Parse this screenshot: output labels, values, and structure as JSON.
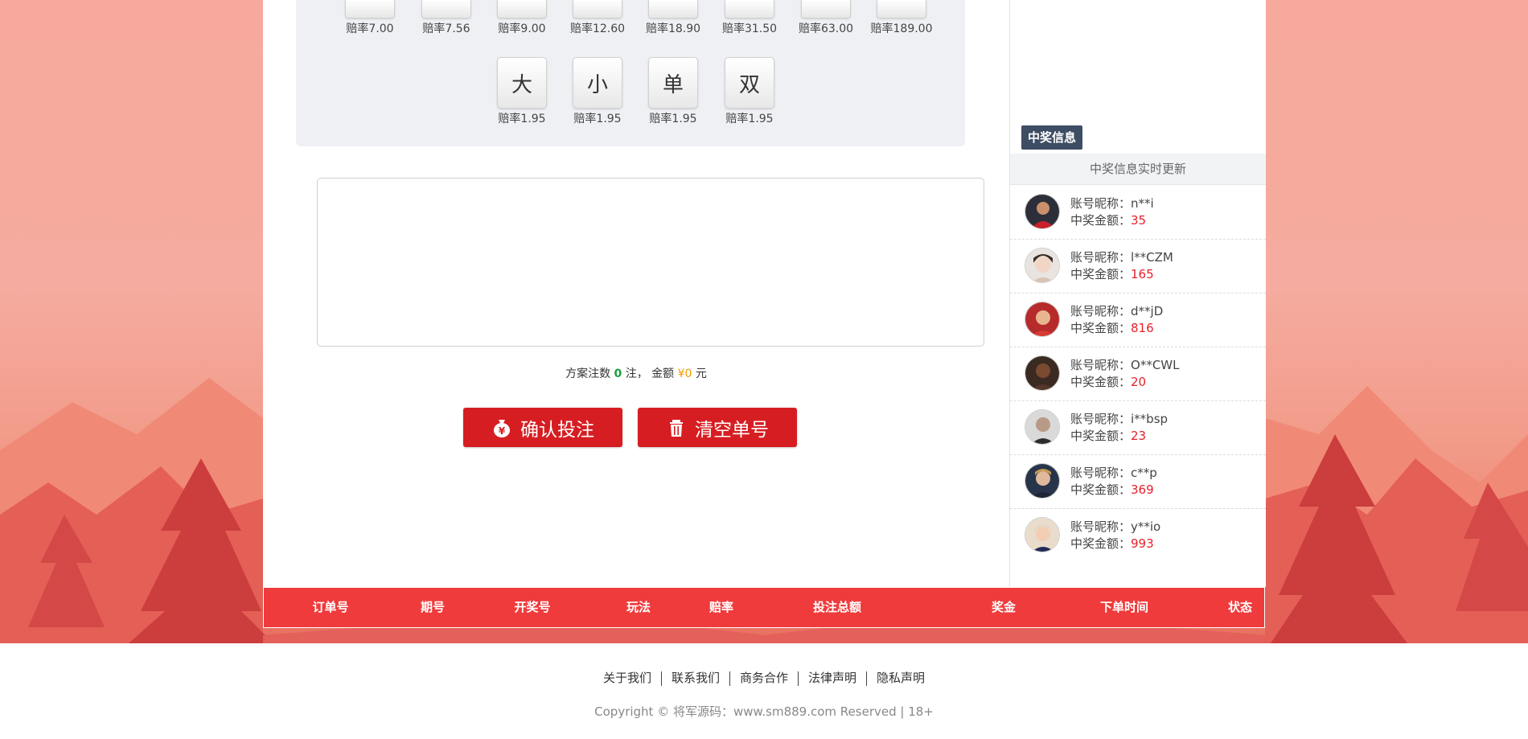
{
  "colors": {
    "accent_red": "#d61e22",
    "table_header_red": "#ef3b3c",
    "count_green": "#1a9f3a",
    "money_orange": "#f59c00",
    "amount_red": "#e8202a",
    "badge_navy": "#3d4d63"
  },
  "odds": {
    "row1": [
      "赔率7.00",
      "赔率7.56",
      "赔率9.00",
      "赔率12.60",
      "赔率18.90",
      "赔率31.50",
      "赔率63.00",
      "赔率189.00"
    ],
    "row2": [
      {
        "key": "大",
        "rate": "赔率1.95"
      },
      {
        "key": "小",
        "rate": "赔率1.95"
      },
      {
        "key": "单",
        "rate": "赔率1.95"
      },
      {
        "key": "双",
        "rate": "赔率1.95"
      }
    ]
  },
  "bet_input": {
    "value": ""
  },
  "summary": {
    "prefix": "方案注数",
    "count": "0",
    "mid": "注，  金额",
    "amount": "¥0",
    "suffix": "元"
  },
  "actions": {
    "confirm_label": "确认投注",
    "confirm_icon": "money-bag-icon",
    "clear_label": "清空单号",
    "clear_icon": "trash-icon"
  },
  "orders_table": {
    "columns": [
      "订单号",
      "期号",
      "开奖号",
      "玩法",
      "赔率",
      "投注总额",
      "奖金",
      "下单时间",
      "状态"
    ]
  },
  "winners_panel": {
    "badge": "中奖信息",
    "subtitle": "中奖信息实时更新",
    "name_label": "账号昵称：",
    "amount_label": "中奖金额：",
    "items": [
      {
        "name": "n**i",
        "amount": "35"
      },
      {
        "name": "l**CZM",
        "amount": "165"
      },
      {
        "name": "d**jD",
        "amount": "816"
      },
      {
        "name": "O**CWL",
        "amount": "20"
      },
      {
        "name": "i**bsp",
        "amount": "23"
      },
      {
        "name": "c**p",
        "amount": "369"
      },
      {
        "name": "y**io",
        "amount": "993"
      }
    ]
  },
  "footer": {
    "links": [
      "关于我们",
      "联系我们",
      "商务合作",
      "法律声明",
      "隐私声明"
    ],
    "copyright": "Copyright © 将军源码：www.sm889.com Reserved | 18+"
  }
}
